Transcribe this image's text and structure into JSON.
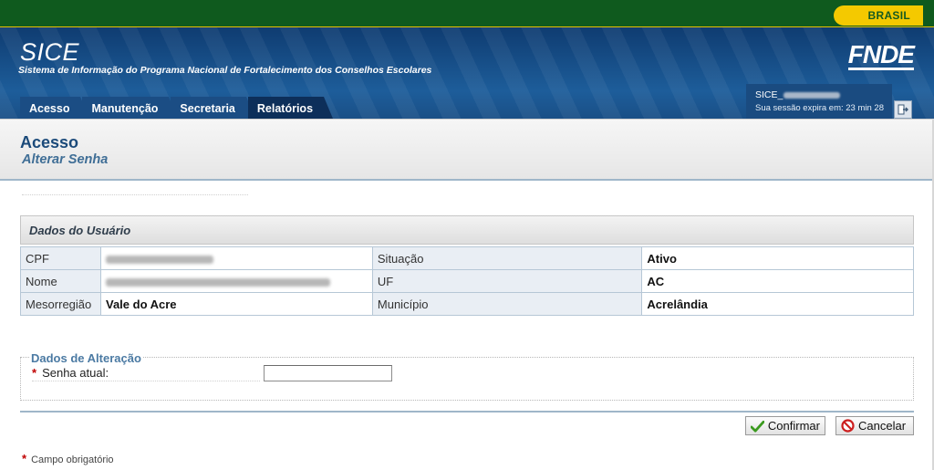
{
  "gov_bar": {
    "badge": "BRASIL"
  },
  "header": {
    "app_name": "SICE",
    "app_subtitle": "Sistema de Informação do Programa Nacional de Fortalecimento dos Conselhos Escolares",
    "partner_logo": "FNDE"
  },
  "menu": {
    "items": [
      {
        "label": "Acesso"
      },
      {
        "label": "Manutenção"
      },
      {
        "label": "Secretaria"
      },
      {
        "label": "Relatórios"
      }
    ]
  },
  "session": {
    "user_prefix": "SICE_",
    "expire_text": "Sua sessão expira em: 23 min 28"
  },
  "page": {
    "title": "Acesso",
    "subtitle": "Alterar Senha"
  },
  "user_panel": {
    "title": "Dados do Usuário",
    "rows": [
      {
        "label1": "CPF",
        "value1": "",
        "label2": "Situação",
        "value2": "Ativo"
      },
      {
        "label1": "Nome",
        "value1": "",
        "label2": "UF",
        "value2": "AC"
      },
      {
        "label1": "Mesorregião",
        "value1": "Vale do Acre",
        "label2": "Município",
        "value2": "Acrelândia"
      }
    ]
  },
  "alteration": {
    "legend": "Dados de Alteração",
    "required_mark": "*",
    "current_password_label": "Senha atual:",
    "current_password_value": ""
  },
  "actions": {
    "confirm": "Confirmar",
    "cancel": "Cancelar"
  },
  "footnote": {
    "mark": "*",
    "text": "Campo obrigatório"
  },
  "colors": {
    "header_blue": "#1d5d9a",
    "gov_green": "#0f5a1e",
    "brasil_yellow": "#f4c900",
    "title_blue": "#1b4a7a",
    "required_red": "#c00000"
  }
}
